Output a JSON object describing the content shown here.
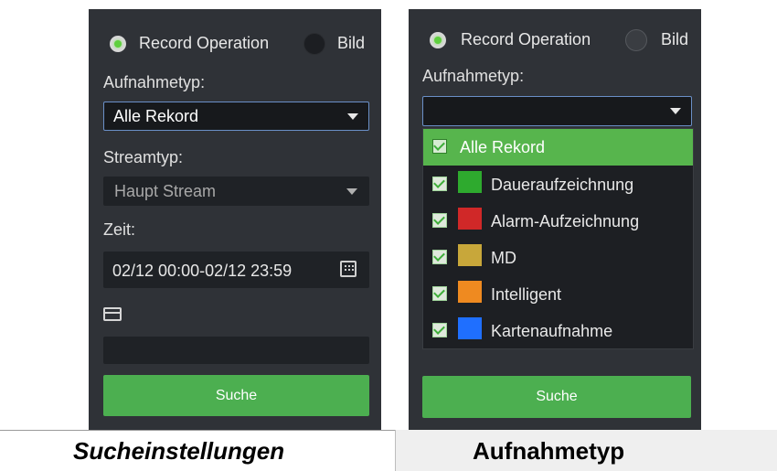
{
  "left_panel": {
    "radio_record_label": "Record Operation",
    "radio_image_label": "Bild",
    "record_type_label": "Aufnahmetyp:",
    "record_type_value": "Alle Rekord",
    "stream_type_label": "Streamtyp:",
    "stream_type_value": "Haupt Stream",
    "time_label": "Zeit:",
    "time_value": "02/12 00:00-02/12 23:59",
    "card_icon": "card-icon",
    "calendar_icon": "calendar-icon",
    "card_value": "",
    "search_label": "Suche"
  },
  "right_panel": {
    "radio_record_label": "Record Operation",
    "radio_image_label": "Bild",
    "record_type_label": "Aufnahmetyp:",
    "record_type_value": "",
    "options": [
      {
        "label": "Alle Rekord",
        "checked": true,
        "color": ""
      },
      {
        "label": "Daueraufzeichnung",
        "checked": true,
        "color": "#2eaa2e"
      },
      {
        "label": "Alarm-Aufzeichnung",
        "checked": true,
        "color": "#d02828"
      },
      {
        "label": "MD",
        "checked": true,
        "color": "#c8a73a"
      },
      {
        "label": "Intelligent",
        "checked": true,
        "color": "#ef8a20"
      },
      {
        "label": "Kartenaufnahme",
        "checked": true,
        "color": "#1f6fff"
      }
    ],
    "search_label": "Suche"
  },
  "captions": {
    "left": "Sucheinstellungen",
    "right": "Aufnahmetyp"
  },
  "colors": {
    "panel_bg": "#2f3237",
    "field_bg": "#1f2226",
    "accent_green": "#4caf50",
    "highlight_green": "#57b54d"
  }
}
